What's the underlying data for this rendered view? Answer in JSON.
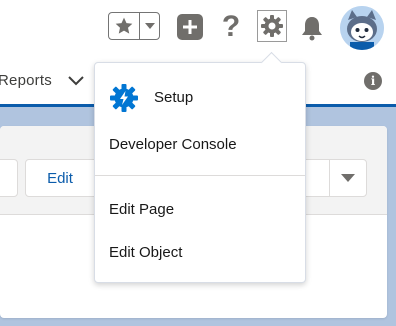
{
  "header": {
    "favorites_star_icon": "star-icon",
    "favorites_caret_icon": "caret-down-icon",
    "global_actions_icon": "plus-icon",
    "help_label": "?",
    "setup_gear_icon": "gear-icon",
    "notifications_icon": "bell-icon",
    "avatar_icon": "avatar"
  },
  "nav": {
    "reports_label": "Reports",
    "chevron_icon": "chevron-down-icon",
    "info_label": "i"
  },
  "record": {
    "edit_label": "Edit",
    "more_actions_icon": "caret-down-icon"
  },
  "setup_menu": {
    "setup_label": "Setup",
    "developer_console_label": "Developer Console",
    "edit_page_label": "Edit Page",
    "edit_object_label": "Edit Object"
  },
  "colors": {
    "brand_blue": "#0b5cab",
    "icon_gray": "#706e6b",
    "setup_icon_blue": "#0176d3",
    "background": "#b0c4df"
  }
}
